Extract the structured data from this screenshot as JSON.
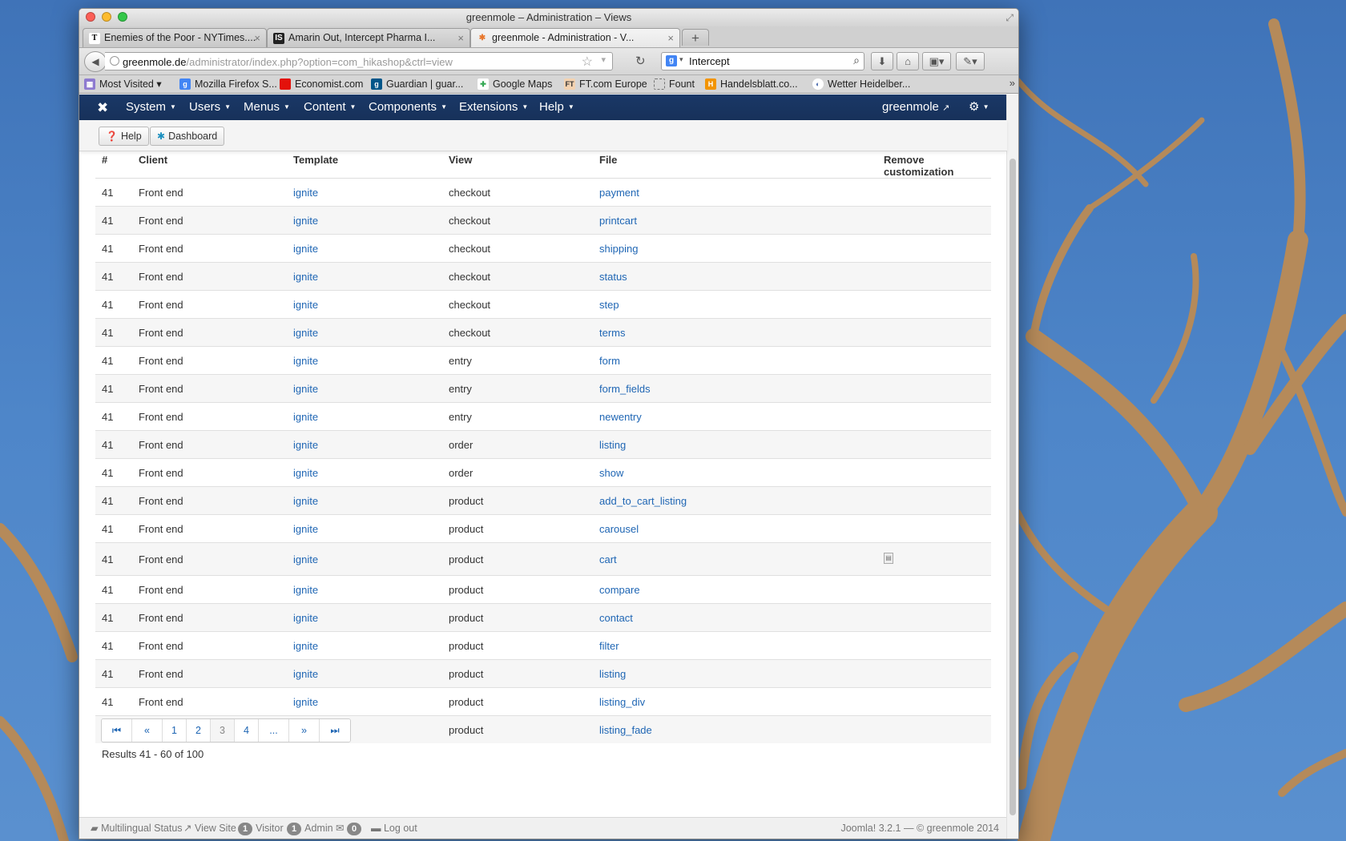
{
  "window": {
    "title": "greenmole – Administration – Views"
  },
  "tabs": [
    {
      "label": "Enemies of the Poor - NYTimes....",
      "favicon": "T"
    },
    {
      "label": "Amarin Out, Intercept Pharma I...",
      "favicon": "IS"
    },
    {
      "label": "greenmole - Administration - V...",
      "favicon": "J"
    }
  ],
  "address": {
    "domain": "greenmole.de",
    "path": "/administrator/index.php?option=com_hikashop&ctrl=view"
  },
  "search": {
    "value": "Intercept"
  },
  "bookmarks": [
    {
      "label": "Most Visited"
    },
    {
      "label": "Mozilla Firefox S..."
    },
    {
      "label": "Economist.com"
    },
    {
      "label": "Guardian | guar..."
    },
    {
      "label": "Google Maps"
    },
    {
      "label": "FT.com Europe"
    },
    {
      "label": "Fount"
    },
    {
      "label": "Handelsblatt.co..."
    },
    {
      "label": "Wetter Heidelber..."
    }
  ],
  "admin_menu": {
    "items": [
      "System",
      "Users",
      "Menus",
      "Content",
      "Components",
      "Extensions",
      "Help"
    ],
    "user": "greenmole"
  },
  "toolbar": {
    "help_label": "Help",
    "dashboard_label": "Dashboard"
  },
  "table": {
    "headers": {
      "num": "#",
      "client": "Client",
      "template": "Template",
      "view": "View",
      "file": "File",
      "remove": "Remove customization"
    },
    "rows": [
      {
        "num": "41",
        "client": "Front end",
        "template": "ignite",
        "view": "checkout",
        "file": "payment"
      },
      {
        "num": "41",
        "client": "Front end",
        "template": "ignite",
        "view": "checkout",
        "file": "printcart"
      },
      {
        "num": "41",
        "client": "Front end",
        "template": "ignite",
        "view": "checkout",
        "file": "shipping"
      },
      {
        "num": "41",
        "client": "Front end",
        "template": "ignite",
        "view": "checkout",
        "file": "status"
      },
      {
        "num": "41",
        "client": "Front end",
        "template": "ignite",
        "view": "checkout",
        "file": "step"
      },
      {
        "num": "41",
        "client": "Front end",
        "template": "ignite",
        "view": "checkout",
        "file": "terms"
      },
      {
        "num": "41",
        "client": "Front end",
        "template": "ignite",
        "view": "entry",
        "file": "form"
      },
      {
        "num": "41",
        "client": "Front end",
        "template": "ignite",
        "view": "entry",
        "file": "form_fields"
      },
      {
        "num": "41",
        "client": "Front end",
        "template": "ignite",
        "view": "entry",
        "file": "newentry"
      },
      {
        "num": "41",
        "client": "Front end",
        "template": "ignite",
        "view": "order",
        "file": "listing"
      },
      {
        "num": "41",
        "client": "Front end",
        "template": "ignite",
        "view": "order",
        "file": "show"
      },
      {
        "num": "41",
        "client": "Front end",
        "template": "ignite",
        "view": "product",
        "file": "add_to_cart_listing"
      },
      {
        "num": "41",
        "client": "Front end",
        "template": "ignite",
        "view": "product",
        "file": "carousel"
      },
      {
        "num": "41",
        "client": "Front end",
        "template": "ignite",
        "view": "product",
        "file": "cart",
        "remove_icon": true
      },
      {
        "num": "41",
        "client": "Front end",
        "template": "ignite",
        "view": "product",
        "file": "compare"
      },
      {
        "num": "41",
        "client": "Front end",
        "template": "ignite",
        "view": "product",
        "file": "contact"
      },
      {
        "num": "41",
        "client": "Front end",
        "template": "ignite",
        "view": "product",
        "file": "filter"
      },
      {
        "num": "41",
        "client": "Front end",
        "template": "ignite",
        "view": "product",
        "file": "listing"
      },
      {
        "num": "41",
        "client": "Front end",
        "template": "ignite",
        "view": "product",
        "file": "listing_div"
      },
      {
        "num": "41",
        "client": "Front end",
        "template": "ignite",
        "view": "product",
        "file": "listing_fade"
      }
    ]
  },
  "pagination": {
    "pages": [
      "1",
      "2",
      "3",
      "4",
      "..."
    ],
    "current": "3",
    "results": "Results 41 - 60 of 100"
  },
  "status": {
    "multilingual": "Multilingual Status",
    "view_site": "View Site",
    "visitor_count": "1",
    "visitor_label": "Visitor",
    "admin_count": "1",
    "admin_label": "Admin",
    "messages_count": "0",
    "logout": "Log out",
    "footer": "Joomla! 3.2.1 — © greenmole 2014"
  },
  "colors": {
    "nav_bg": "#17315a",
    "link": "#1f66b4"
  }
}
